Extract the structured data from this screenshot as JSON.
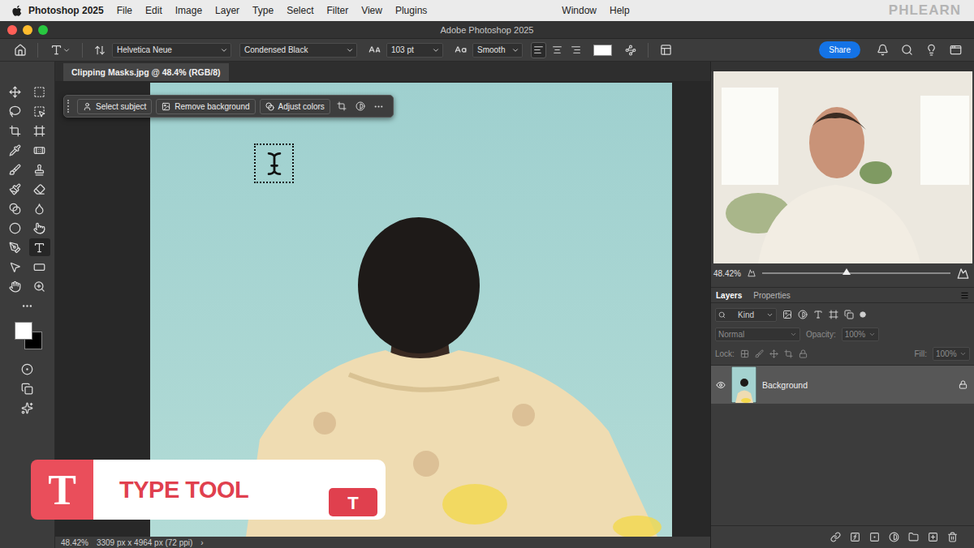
{
  "menu_bar": {
    "app": "Photoshop 2025",
    "items": [
      "File",
      "Edit",
      "Image",
      "Layer",
      "Type",
      "Select",
      "Filter",
      "View",
      "Plugins"
    ],
    "right_items": [
      "Window",
      "Help"
    ],
    "watermark": "PHLEARN"
  },
  "window": {
    "title": "Adobe Photoshop 2025"
  },
  "options_bar": {
    "font_family": "Helvetica Neue",
    "font_style": "Condensed Black",
    "font_size": "103 pt",
    "anti_alias": "Smooth",
    "align": [
      {
        "selected": true
      },
      {
        "selected": false
      },
      {
        "selected": false
      }
    ],
    "text_color": "#ffffff",
    "share": "Share"
  },
  "document_tab": {
    "label": "Clipping Masks.jpg @ 48.4% (RGB/8)"
  },
  "contextual_bar": {
    "buttons": [
      "Select subject",
      "Remove background",
      "Adjust colors"
    ]
  },
  "tools": [
    {
      "selected": false
    },
    {
      "selected": false
    },
    {
      "selected": false
    },
    {
      "selected": false
    },
    {
      "selected": false
    },
    {
      "selected": false
    },
    {
      "selected": false
    },
    {
      "selected": false
    },
    {
      "selected": false
    },
    {
      "selected": false
    },
    {
      "selected": false
    },
    {
      "selected": false
    },
    {
      "selected": false
    },
    {
      "selected": false
    },
    {
      "selected": false
    },
    {
      "selected": false
    },
    {
      "selected": false
    },
    {
      "selected": true
    },
    {
      "selected": false
    },
    {
      "selected": false
    },
    {
      "selected": false
    },
    {
      "selected": false
    }
  ],
  "swatches": [
    {
      "color": "#ffffff"
    },
    {
      "color": "#000000"
    }
  ],
  "overlay": {
    "icon_letter": "T",
    "label": "TYPE TOOL",
    "key": "T"
  },
  "status_bar": {
    "zoom": "48.42%",
    "dimensions": "3309 px x 4964 px (72 ppi)",
    "arrow": "›"
  },
  "navigator": {
    "zoom": "48.42%",
    "level": 0.45
  },
  "layers_panel": {
    "tabs": [
      {
        "label": "Layers",
        "selected": true
      },
      {
        "label": "Properties",
        "selected": false
      }
    ],
    "filter": "Kind",
    "blend_mode": "Normal",
    "opacity_label": "Opacity:",
    "opacity": "100%",
    "lock_label": "Lock:",
    "fill_label": "Fill:",
    "fill": "100%",
    "disabled": true,
    "layers": [
      {
        "name": "Background",
        "visible": true,
        "locked": true,
        "selected": true
      }
    ]
  }
}
